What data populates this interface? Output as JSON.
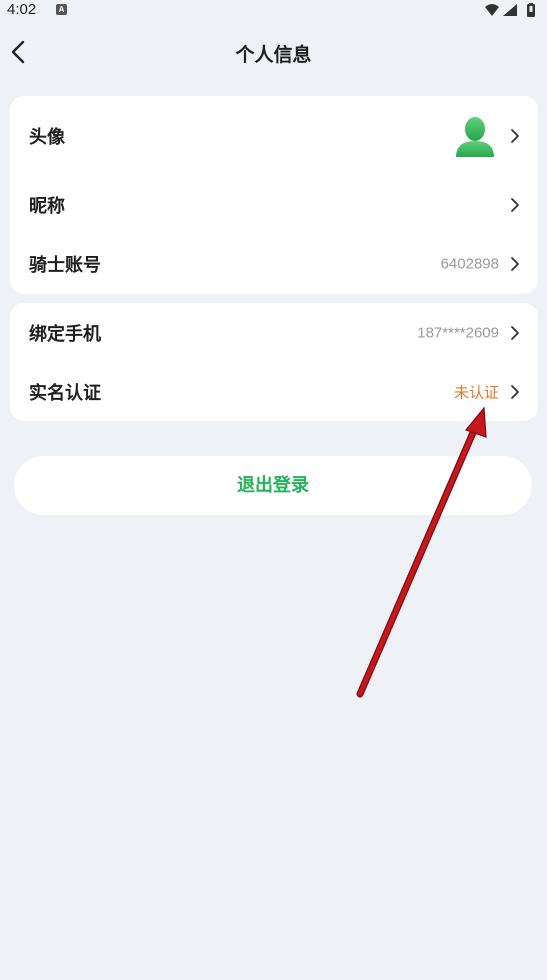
{
  "status_bar": {
    "time": "4:02",
    "app_icon_letter": "A",
    "icons": [
      "wifi-icon",
      "signal-icon",
      "battery-icon"
    ]
  },
  "header": {
    "title": "个人信息",
    "back_icon": "chevron-left-icon"
  },
  "profile_card": {
    "avatar_label": "头像",
    "nickname_label": "昵称",
    "nickname_value": "",
    "account_label": "骑士账号",
    "account_value": "6402898"
  },
  "security_card": {
    "phone_label": "绑定手机",
    "phone_value": "187****2609",
    "realname_label": "实名认证",
    "realname_value": "未认证"
  },
  "logout": {
    "label": "退出登录"
  },
  "colors": {
    "background": "#eef1f5",
    "card": "#ffffff",
    "accent_green": "#23b35a",
    "warning_orange": "#e07a2e",
    "muted_text": "#9a9a9a",
    "annotation_red": "#c8161d"
  }
}
